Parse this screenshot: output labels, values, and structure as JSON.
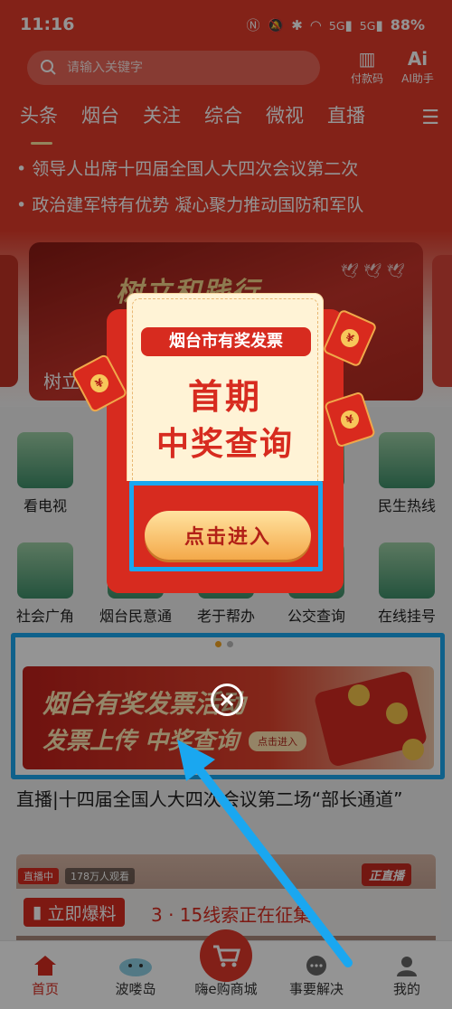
{
  "status": {
    "time": "11:16",
    "network1": "5G",
    "network2": "5G",
    "battery": "88%"
  },
  "search": {
    "placeholder": "请输入关键字"
  },
  "top_buttons": {
    "pay_code": "付款码",
    "ai_assistant": "AI助手"
  },
  "tabs": [
    "头条",
    "烟台",
    "关注",
    "综合",
    "微视",
    "直播"
  ],
  "news_ticker": [
    "• 领导人出席十四届全国人大四次会议第二次",
    "• 政治建军特有优势 凝心聚力推动国防和军队"
  ],
  "banner": {
    "title": "树立和践行",
    "caption": "树立"
  },
  "grid": {
    "row1": [
      "看电视",
      "",
      "",
      "",
      "民生热线"
    ],
    "row2": [
      "社会广角",
      "烟台民意通",
      "老于帮办",
      "公交查询",
      "在线挂号"
    ]
  },
  "ad": {
    "line1": "烟台有奖发票活动",
    "line2": "发票上传 中奖查询",
    "enter": "点击进入"
  },
  "headline": "直播|十四届全国人大四次会议第二场“部长通道”",
  "video": {
    "live_badge": "直播中",
    "viewers": "178万人观看",
    "brand": "正直播"
  },
  "hotline": {
    "button": "立即爆料",
    "text": "3 · 15线索正在征集"
  },
  "bottom_nav": [
    "首页",
    "波喽岛",
    "嗨e购商城",
    "事要解决",
    "我的"
  ],
  "popup": {
    "ribbon": "烟台市有奖发票",
    "line1": "首期",
    "line2": "中奖查询",
    "button": "点击进入"
  },
  "colors": {
    "brand_red": "#e23b2a",
    "highlight_blue": "#1aa7f0",
    "gold": "#f5c44b"
  }
}
